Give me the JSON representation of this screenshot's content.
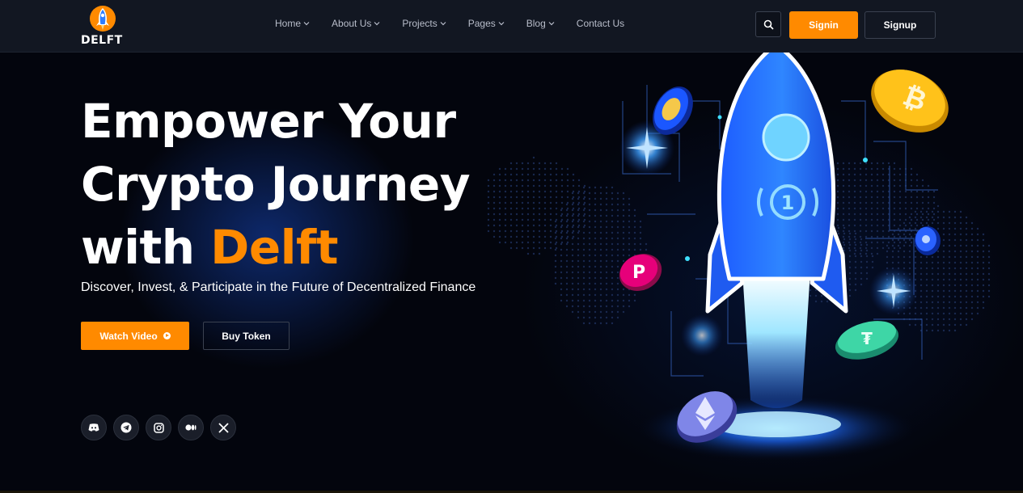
{
  "brand": {
    "name": "DELFT"
  },
  "nav": {
    "items": [
      {
        "label": "Home",
        "has_dropdown": true
      },
      {
        "label": "About Us",
        "has_dropdown": true
      },
      {
        "label": "Projects",
        "has_dropdown": true
      },
      {
        "label": "Pages",
        "has_dropdown": true
      },
      {
        "label": "Blog",
        "has_dropdown": true
      },
      {
        "label": "Contact Us",
        "has_dropdown": false
      }
    ]
  },
  "header_actions": {
    "search_icon": "search-icon",
    "signin_label": "Signin",
    "signup_label": "Signup"
  },
  "hero": {
    "headline_line1": "Empower Your",
    "headline_line2": "Crypto Journey",
    "headline_line3_prefix": "with ",
    "headline_accent": "Delft",
    "subtitle": "Discover, Invest, & Participate in the Future of Decentralized Finance",
    "watch_video_label": "Watch Video",
    "buy_token_label": "Buy Token"
  },
  "socials": [
    {
      "icon": "discord-icon"
    },
    {
      "icon": "telegram-icon"
    },
    {
      "icon": "instagram-icon"
    },
    {
      "icon": "medium-icon"
    },
    {
      "icon": "x-icon"
    }
  ],
  "colors": {
    "accent": "#ff8a00",
    "header_bg": "#121722",
    "page_bg": "#03050d",
    "rocket_blue": "#2f7dff"
  },
  "illustration": {
    "rocket_badge": "1",
    "coins": [
      "bitcoin-coin",
      "terra-coin",
      "polkadot-coin",
      "tether-coin",
      "ethereum-coin",
      "cardano-coin"
    ]
  }
}
